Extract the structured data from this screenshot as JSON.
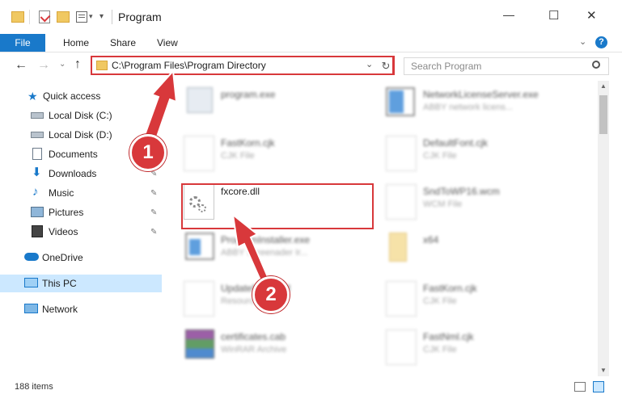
{
  "window": {
    "title": "Program",
    "minimize": "—",
    "maximize": "☐",
    "close": "✕"
  },
  "ribbon": {
    "tabs": [
      {
        "label": "File"
      },
      {
        "label": "Home"
      },
      {
        "label": "Share"
      },
      {
        "label": "View"
      }
    ],
    "help": "?"
  },
  "address": {
    "path": "C:\\Program Files\\Program Directory",
    "search_placeholder": "Search Program"
  },
  "sidebar": {
    "items": [
      {
        "label": "Quick access",
        "icon": "star-icon"
      },
      {
        "label": "Local Disk (C:)",
        "icon": "drive-icon"
      },
      {
        "label": "Local Disk (D:)",
        "icon": "drive-icon"
      },
      {
        "label": "Documents",
        "icon": "documents-icon"
      },
      {
        "label": "Downloads",
        "icon": "downloads-icon"
      },
      {
        "label": "Music",
        "icon": "music-icon"
      },
      {
        "label": "Pictures",
        "icon": "pictures-icon"
      },
      {
        "label": "Videos",
        "icon": "videos-icon"
      },
      {
        "label": "OneDrive",
        "icon": "cloud-icon"
      },
      {
        "label": "This PC",
        "icon": "computer-icon"
      },
      {
        "label": "Network",
        "icon": "network-icon"
      }
    ]
  },
  "files": [
    {
      "name": "program.exe",
      "type": ""
    },
    {
      "name": "NetworkLicenseServer.exe",
      "type": "ABBY network licens..."
    },
    {
      "name": "FastKorn.cjk",
      "type": "CJK File"
    },
    {
      "name": "DefaultFont.cjk",
      "type": "CJK File"
    },
    {
      "name": "fxcore.dll",
      "type": ""
    },
    {
      "name": "SndToWP16.wcm",
      "type": "WCM File"
    },
    {
      "name": "ProgramInstaller.exe",
      "type": "ABBY Screenader Ir..."
    },
    {
      "name": "x64",
      "type": ""
    },
    {
      "name": "UpdateNet65.dll",
      "type": "Resource"
    },
    {
      "name": "FastKorn.cjk",
      "type": "CJK File"
    },
    {
      "name": "certificates.cab",
      "type": "WinRAR Archive"
    },
    {
      "name": "FastNml.cjk",
      "type": "CJK File"
    }
  ],
  "status": {
    "count": "188 items"
  },
  "callouts": {
    "step1": "1",
    "step2": "2"
  },
  "colors": {
    "accent": "#1979ca",
    "highlight": "#d8383b",
    "selected_nav": "#cce8ff"
  }
}
